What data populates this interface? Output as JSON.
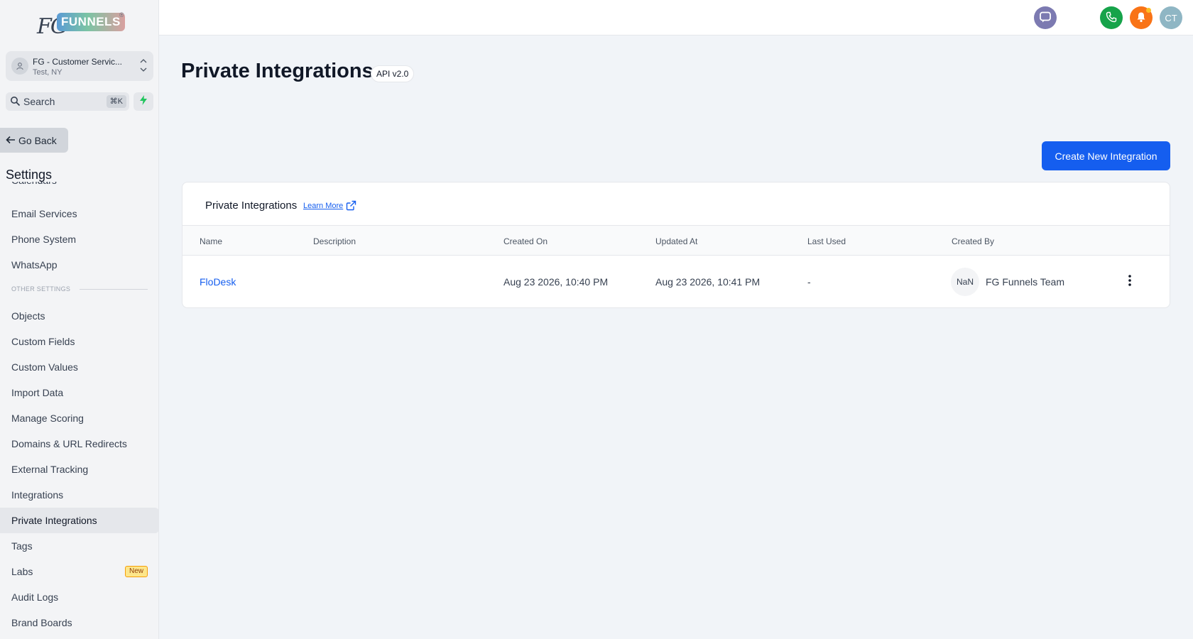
{
  "brand": {
    "logo_prefix": "FG",
    "logo_word": "FUNNELS",
    "logo_mark": "®"
  },
  "account": {
    "name": "FG - Customer Servic...",
    "location": "Test, NY"
  },
  "search": {
    "label": "Search",
    "shortcut": "⌘K"
  },
  "nav": {
    "go_back": "Go Back",
    "settings_title": "Settings"
  },
  "sidebar": {
    "items_top": [
      "Calendars",
      "Email Services",
      "Phone System",
      "WhatsApp"
    ],
    "section_label": "OTHER SETTINGS",
    "items": [
      {
        "label": "Objects"
      },
      {
        "label": "Custom Fields"
      },
      {
        "label": "Custom Values"
      },
      {
        "label": "Import Data"
      },
      {
        "label": "Manage Scoring"
      },
      {
        "label": "Domains & URL Redirects"
      },
      {
        "label": "External Tracking"
      },
      {
        "label": "Integrations"
      },
      {
        "label": "Private Integrations",
        "active": true
      },
      {
        "label": "Tags"
      },
      {
        "label": "Labs",
        "badge": "New"
      },
      {
        "label": "Audit Logs"
      },
      {
        "label": "Brand Boards"
      }
    ]
  },
  "topbar": {
    "user_initials": "CT",
    "icons": [
      "chat-icon",
      "phone-icon",
      "bell-icon"
    ]
  },
  "page": {
    "title": "Private Integrations",
    "api_badge": "API v2.0",
    "create_button": "Create New Integration"
  },
  "card": {
    "title": "Private Integrations",
    "learn_more": "Learn More",
    "columns": [
      "Name",
      "Description",
      "Created On",
      "Updated At",
      "Last Used",
      "Created By"
    ],
    "rows": [
      {
        "name": "FloDesk",
        "description": "",
        "created_on": "Aug 23 2026, 10:40 PM",
        "updated_at": "Aug 23 2026, 10:41 PM",
        "last_used": "-",
        "creator_initials": "NaN",
        "created_by": "FG Funnels Team"
      }
    ]
  },
  "colors": {
    "primary": "#155eef",
    "phone": "#16a34a",
    "bell": "#f97316",
    "chat": "#7c7ab1"
  }
}
